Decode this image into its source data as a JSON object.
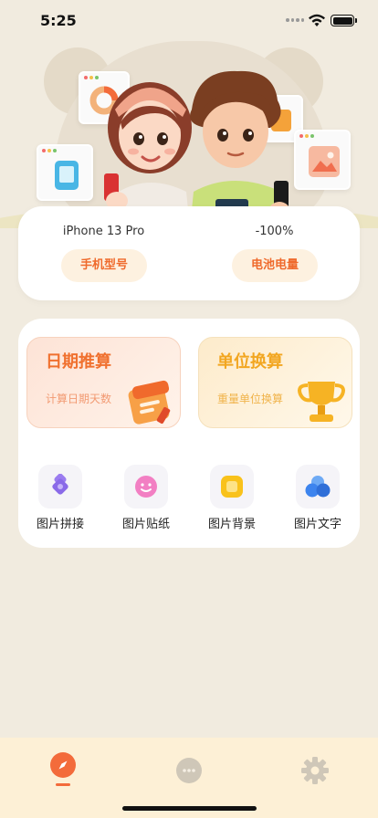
{
  "status_bar": {
    "time": "5:25"
  },
  "colors": {
    "accent": "#f36b3b",
    "background": "#f1ebdf",
    "tab_bar": "#fdf0d6",
    "date_accent": "#f0702e",
    "unit_accent": "#f2a620"
  },
  "device_info": {
    "model": {
      "value": "iPhone 13 Pro",
      "label": "手机型号"
    },
    "battery": {
      "value": "-100%",
      "label": "电池电量"
    }
  },
  "features": [
    {
      "title": "日期推算",
      "subtitle": "计算日期天数",
      "icon": "calendar-icon"
    },
    {
      "title": "单位换算",
      "subtitle": "重量单位换算",
      "icon": "trophy-icon"
    }
  ],
  "tools": [
    {
      "label": "图片拼接",
      "icon": "puzzle-icon"
    },
    {
      "label": "图片贴纸",
      "icon": "sticker-smile-icon"
    },
    {
      "label": "图片背景",
      "icon": "background-square-icon"
    },
    {
      "label": "图片文字",
      "icon": "text-bubbles-icon"
    }
  ],
  "tab_bar": {
    "tabs": [
      {
        "icon": "compass-icon",
        "active": true
      },
      {
        "icon": "chat-icon",
        "active": false
      },
      {
        "icon": "gear-icon",
        "active": false
      }
    ]
  }
}
